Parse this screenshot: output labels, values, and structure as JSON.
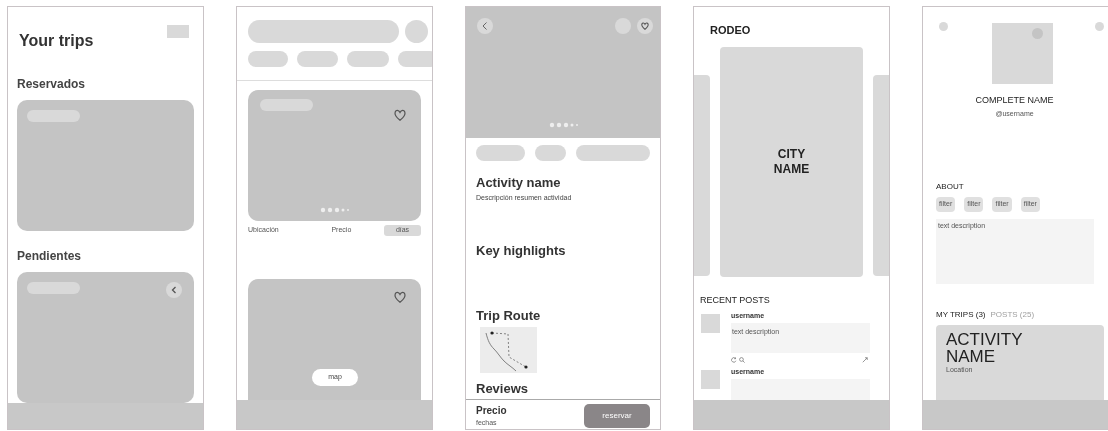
{
  "screens": [
    {
      "kind": "trips",
      "title": "Your trips",
      "sections": [
        {
          "heading": "Reservados"
        },
        {
          "heading": "Pendientes"
        }
      ]
    },
    {
      "kind": "explore",
      "info": {
        "location": "Ubicación",
        "price": "Precio",
        "chip": "días"
      },
      "map_button": "map"
    },
    {
      "kind": "activity",
      "title": "Activity name",
      "description": "Descripción resumen actividad",
      "sections": [
        "Key highlights",
        "Trip Route",
        "Reviews"
      ],
      "footer": {
        "price": "Precio",
        "dates": "fechas",
        "button": "reservar"
      }
    },
    {
      "kind": "city",
      "brand": "RODEO",
      "city": "CITY NAME",
      "posts_heading": "RECENT POSTS",
      "posts": [
        {
          "username": "username",
          "text": "text description"
        },
        {
          "username": "username"
        }
      ]
    },
    {
      "kind": "profile",
      "name": "COMPLETE NAME",
      "handle": "@username",
      "about_heading": "ABOUT",
      "filters": [
        "filter",
        "filter",
        "filter",
        "filter"
      ],
      "about_text": "text description",
      "tabs": [
        {
          "label": "MY TRIPS (3)",
          "selected": true
        },
        {
          "label": "POSTS (25)",
          "selected": false
        }
      ],
      "trip_card": {
        "title": "ACTIVITY NAME",
        "location": "Location"
      }
    }
  ]
}
